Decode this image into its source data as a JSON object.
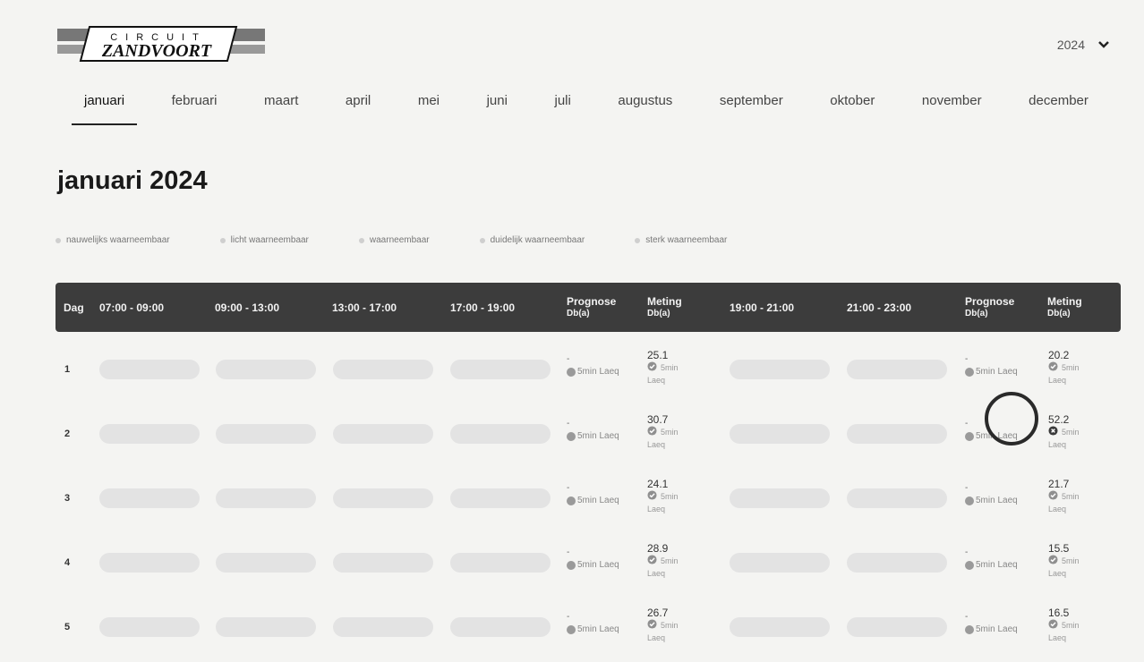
{
  "logo": {
    "line1": "CIRCUIT",
    "line2": "ZANDVOORT"
  },
  "year_select": {
    "value": "2024"
  },
  "months": [
    {
      "label": "januari",
      "active": true
    },
    {
      "label": "februari"
    },
    {
      "label": "maart"
    },
    {
      "label": "april"
    },
    {
      "label": "mei"
    },
    {
      "label": "juni"
    },
    {
      "label": "juli"
    },
    {
      "label": "augustus"
    },
    {
      "label": "september"
    },
    {
      "label": "oktober"
    },
    {
      "label": "november"
    },
    {
      "label": "december"
    }
  ],
  "page_title": "januari 2024",
  "legend": [
    "nauwelijks waarneembaar",
    "licht waarneembaar",
    "waarneembaar",
    "duidelijk waarneembaar",
    "sterk waarneembaar"
  ],
  "table": {
    "headers": {
      "day": "Dag",
      "t1": "07:00 - 09:00",
      "t2": "09:00 - 13:00",
      "t3": "13:00 - 17:00",
      "t4": "17:00 - 19:00",
      "prog1": "Prognose",
      "prog1_unit": "Db(a)",
      "meet1": "Meting",
      "meet1_unit": "Db(a)",
      "t5": "19:00 - 21:00",
      "t6": "21:00 - 23:00",
      "prog2": "Prognose",
      "prog2_unit": "Db(a)",
      "meet2": "Meting",
      "meet2_unit": "Db(a)"
    },
    "prog_dash": "-",
    "prog_sub": "5min Laeq",
    "meet_sub": "5min",
    "meet_sub2": "Laeq",
    "rows": [
      {
        "day": "1",
        "meet1": "25.1",
        "meet1_status": "ok",
        "meet2": "20.2",
        "meet2_status": "ok"
      },
      {
        "day": "2",
        "meet1": "30.7",
        "meet1_status": "ok",
        "meet2": "52.2",
        "meet2_status": "error"
      },
      {
        "day": "3",
        "meet1": "24.1",
        "meet1_status": "ok",
        "meet2": "21.7",
        "meet2_status": "ok"
      },
      {
        "day": "4",
        "meet1": "28.9",
        "meet1_status": "ok",
        "meet2": "15.5",
        "meet2_status": "ok"
      },
      {
        "day": "5",
        "meet1": "26.7",
        "meet1_status": "ok",
        "meet2": "16.5",
        "meet2_status": "ok"
      }
    ]
  },
  "colors": {
    "header_bg": "#3c3c3c",
    "pill": "#e3e3e3",
    "status_icon": "#9a9a9a"
  },
  "icons": {
    "year_chevron": "chevron-down-icon",
    "status_ok": "check-circle-icon",
    "status_error": "x-circle-icon",
    "prog_status": "dot-icon"
  }
}
